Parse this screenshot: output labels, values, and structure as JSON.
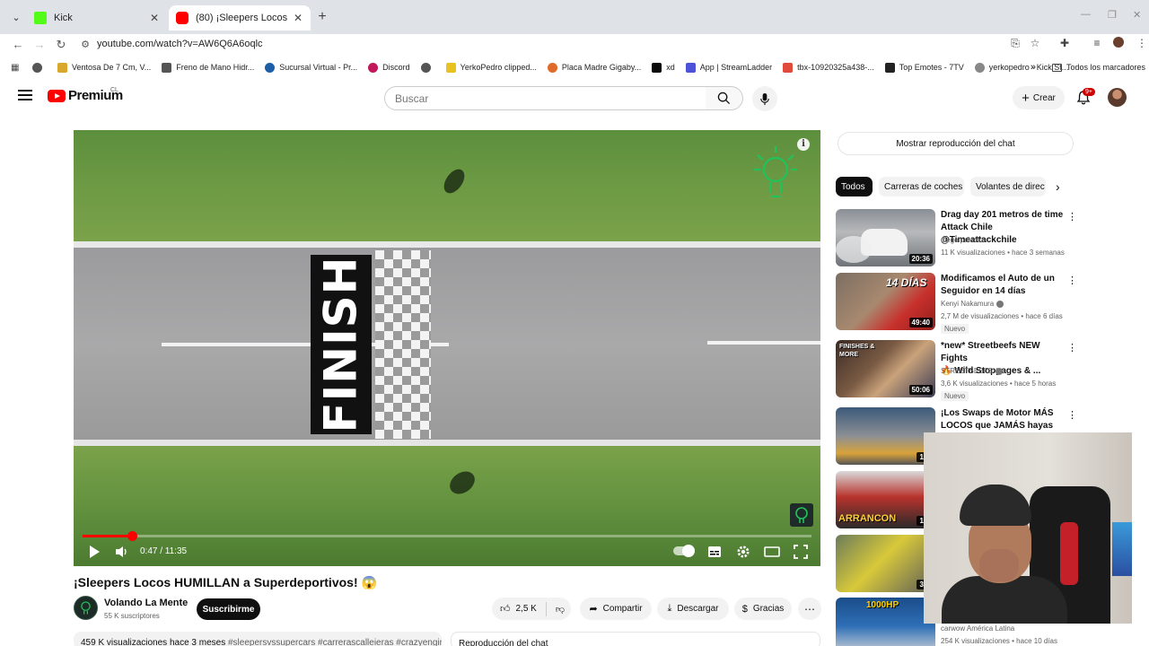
{
  "browser": {
    "tabs": [
      {
        "title": "Kick",
        "favicon_color": "#53fc18"
      },
      {
        "title": "(80) ¡Sleepers Locos HUMILLAN",
        "favicon_color": "#ff0000"
      }
    ],
    "url": "youtube.com/watch?v=AW6Q6A6oqlc",
    "bookmarks": [
      {
        "label": "Ventosa De 7 Cm, V...",
        "color": "#d9a72b"
      },
      {
        "label": "Freno de Mano Hidr...",
        "color": "#555555"
      },
      {
        "label": "Sucursal Virtual - Pr...",
        "color": "#1c5ea8"
      },
      {
        "label": "Discord",
        "color": "#c2185b"
      },
      {
        "label": "YerkoPedro clipped...",
        "color": "#e8c21f"
      },
      {
        "label": "Placa Madre Gigaby...",
        "color": "#e06a2a"
      },
      {
        "label": "xd",
        "color": "#0a0a0a"
      },
      {
        "label": "App | StreamLadder",
        "color": "#4d52d9"
      },
      {
        "label": "tbx-10920325a438-...",
        "color": "#e04a3a"
      },
      {
        "label": "Top Emotes - 7TV",
        "color": "#222222"
      },
      {
        "label": "yerkopedro - Kick St...",
        "color": "#888888"
      }
    ],
    "all_bookmarks": "Todos los marcadores"
  },
  "yt": {
    "logo_text": "Premium",
    "logo_country": "CL",
    "search_placeholder": "Buscar",
    "create_label": "Crear",
    "notif_count": "9+"
  },
  "video": {
    "finish_text": "FINISH",
    "time": "0:47 / 11:35",
    "progress": 0.068,
    "title": "¡Sleepers Locos HUMILLAN a Superdeportivos! 😱",
    "channel": "Volando La Mente",
    "subscribers": "55 K suscriptores",
    "subscribe_label": "Suscribirme",
    "likes": "2,5 K",
    "share_label": "Compartir",
    "download_label": "Descargar",
    "thanks_label": "Gracias",
    "desc_meta": "459 K visualizaciones  hace 3 meses",
    "desc_tags": "#sleepersvssupercars #carrerascalleieras #crazyengine",
    "chat_replay_below": "Reproducción del chat"
  },
  "sidebar": {
    "chat_replay_button": "Mostrar reproducción del chat",
    "chips": [
      "Todos",
      "Carreras de coches",
      "Volantes de direc"
    ],
    "recommendations": [
      {
        "title_1": "Drag day 201 metros de time",
        "title_2": "Attack Chile @Timeattackchile",
        "channel": "diego palacios",
        "meta": "11 K visualizaciones • hace 3 semanas",
        "duration": "20:36",
        "verified": false,
        "new": false
      },
      {
        "title_1": "Modificamos el Auto de un",
        "title_2": "Seguidor en 14 días",
        "channel": "Kenyi Nakamura",
        "meta": "2,7 M de visualizaciones • hace 6 días",
        "duration": "49:40",
        "verified": true,
        "new": true,
        "new_label": "Nuevo",
        "thumb_text": "14 DÍAS"
      },
      {
        "title_1": "*new* Streetbeefs NEW Fights",
        "title_2": "🔥 Wild Stoppages & ...",
        "channel": "STREETBEEFS",
        "meta": "3,6 K visualizaciones • hace 5 horas",
        "duration": "50:06",
        "verified": true,
        "new": true,
        "new_label": "Nuevo",
        "thumb_text": "FINISHES & MORE"
      },
      {
        "title_1": "¡Los Swaps de Motor MÁS",
        "title_2": "LOCOS que JAMÁS hayas visto!",
        "duration": "13:"
      },
      {
        "duration": "18:",
        "thumb_text": "ARRANCON"
      },
      {
        "duration": "34:"
      },
      {
        "channel": "carwow América Latina",
        "meta": "254 K visualizaciones • hace 10 días",
        "thumb_text": "1000HP"
      }
    ]
  }
}
